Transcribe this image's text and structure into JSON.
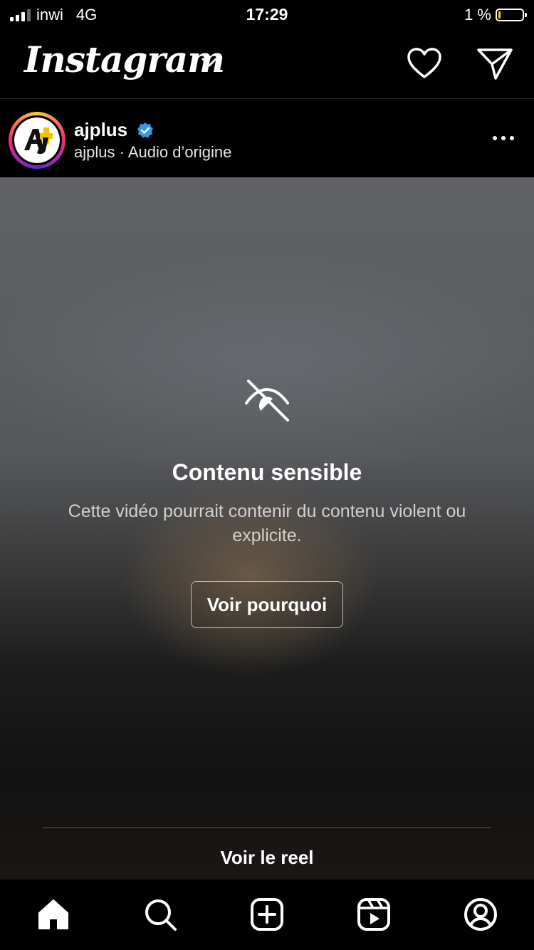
{
  "status_bar": {
    "carrier": "inwi",
    "network": "4G",
    "time": "17:29",
    "battery_text": "1 %",
    "battery_level": 0.01
  },
  "header": {
    "logo": "Instagram",
    "icons": [
      "chevron-down-icon",
      "heart-icon",
      "direct-message-icon"
    ]
  },
  "post": {
    "username": "ajplus",
    "verified": true,
    "subtitle": "ajplus · Audio d’origine",
    "avatar_text": "AJ+"
  },
  "sensitive": {
    "title": "Contenu sensible",
    "description": "Cette vidéo pourrait contenir du contenu violent ou explicite.",
    "button": "Voir pourquoi",
    "reel_link": "Voir le reel"
  },
  "tabbar": {
    "items": [
      "home-icon",
      "search-icon",
      "create-icon",
      "reels-icon",
      "profile-icon"
    ]
  },
  "colors": {
    "verified": "#3897f0",
    "battery_low": "#ffd60a",
    "avatar_yellow": "#f2c400"
  }
}
